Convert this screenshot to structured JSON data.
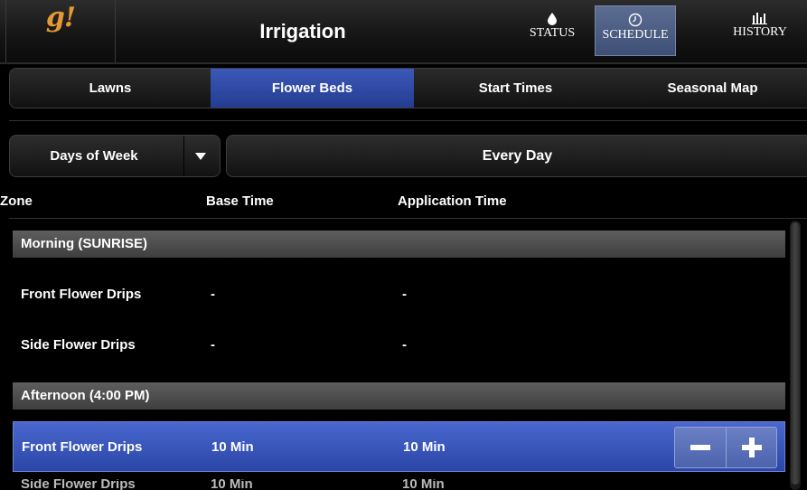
{
  "header": {
    "logo": "g!",
    "title": "Irrigation",
    "buttons": [
      {
        "label": "STATUS",
        "icon": "drop-icon"
      },
      {
        "label": "SCHEDULE",
        "icon": "clock-icon",
        "active": true
      },
      {
        "label": "HISTORY",
        "icon": "bar-chart-icon"
      }
    ]
  },
  "tabs": [
    {
      "label": "Lawns"
    },
    {
      "label": "Flower Beds",
      "active": true
    },
    {
      "label": "Start Times"
    },
    {
      "label": "Seasonal Map"
    }
  ],
  "filter": {
    "dropdown_label": "Days of Week",
    "value": "Every Day"
  },
  "columns": {
    "zone": "Zone",
    "base_time": "Base Time",
    "application_time": "Application Time"
  },
  "sections": [
    {
      "title": "Morning (SUNRISE)",
      "rows": [
        {
          "zone": "Front Flower Drips",
          "base": "-",
          "app": "-"
        },
        {
          "zone": "Side Flower Drips",
          "base": "-",
          "app": "-"
        }
      ]
    },
    {
      "title": "Afternoon (4:00  PM)",
      "rows": [
        {
          "zone": "Front Flower Drips",
          "base": "10 Min",
          "app": "10 Min",
          "selected": true
        },
        {
          "zone": "Side Flower Drips",
          "base": "10 Min",
          "app": "10 Min"
        }
      ]
    }
  ],
  "colors": {
    "accent": "#2f4aa8",
    "logo": "#e39a35",
    "section_bar": "#4a4a4a"
  }
}
